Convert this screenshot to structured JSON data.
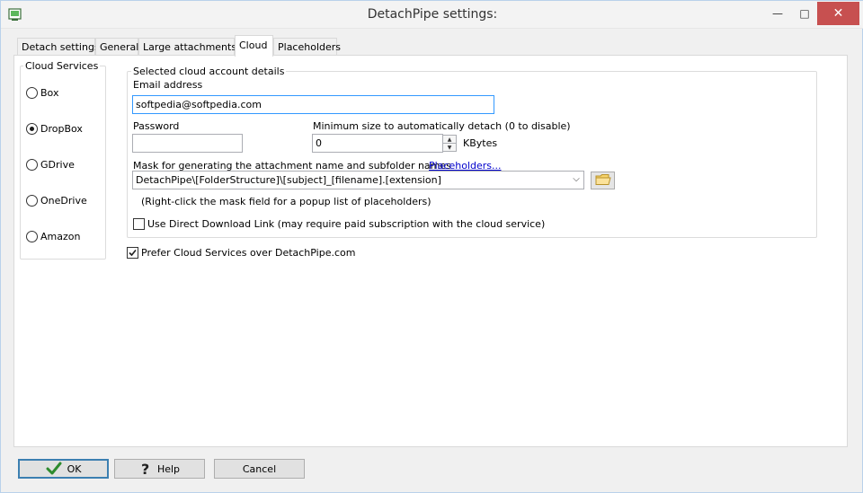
{
  "window": {
    "title": "DetachPipe settings:",
    "controls": {
      "minimize": "—",
      "maximize": "□",
      "close": "✕"
    }
  },
  "tabs": [
    {
      "label": "Detach settings",
      "active": false
    },
    {
      "label": "General",
      "active": false
    },
    {
      "label": "Large attachments?",
      "active": false
    },
    {
      "label": "Cloud",
      "active": true
    },
    {
      "label": "Placeholders",
      "active": false
    }
  ],
  "cloud_services": {
    "group_label": "Cloud Services",
    "options": [
      {
        "label": "Box",
        "checked": false
      },
      {
        "label": "DropBox",
        "checked": true
      },
      {
        "label": "GDrive",
        "checked": false
      },
      {
        "label": "OneDrive",
        "checked": false
      },
      {
        "label": "Amazon",
        "checked": false
      }
    ]
  },
  "account": {
    "group_label": "Selected cloud account details",
    "email_label": "Email address",
    "email_value": "softpedia@softpedia.com",
    "password_label": "Password",
    "password_value": "",
    "min_size_label": "Minimum size to automatically detach (0 to disable)",
    "min_size_value": "0",
    "min_size_unit": "KBytes",
    "mask_label": "Mask for generating the attachment name and subfolder names",
    "placeholders_link": "Placeholders...",
    "mask_value": "DetachPipe\\[FolderStructure]\\[subject]_[filename].[extension]",
    "mask_hint": "(Right-click the mask field for a popup list of placeholders)",
    "direct_link_label": "Use Direct Download Link (may require paid subscription with the cloud service)",
    "direct_link_checked": false
  },
  "prefer_cloud": {
    "label": "Prefer Cloud Services over DetachPipe.com",
    "checked": true
  },
  "buttons": {
    "ok": "OK",
    "help": "Help",
    "cancel": "Cancel"
  },
  "colors": {
    "close_button": "#c75050",
    "link": "#0000cc",
    "focus_border": "#3399ff",
    "ok_check": "#2e8b2e"
  }
}
